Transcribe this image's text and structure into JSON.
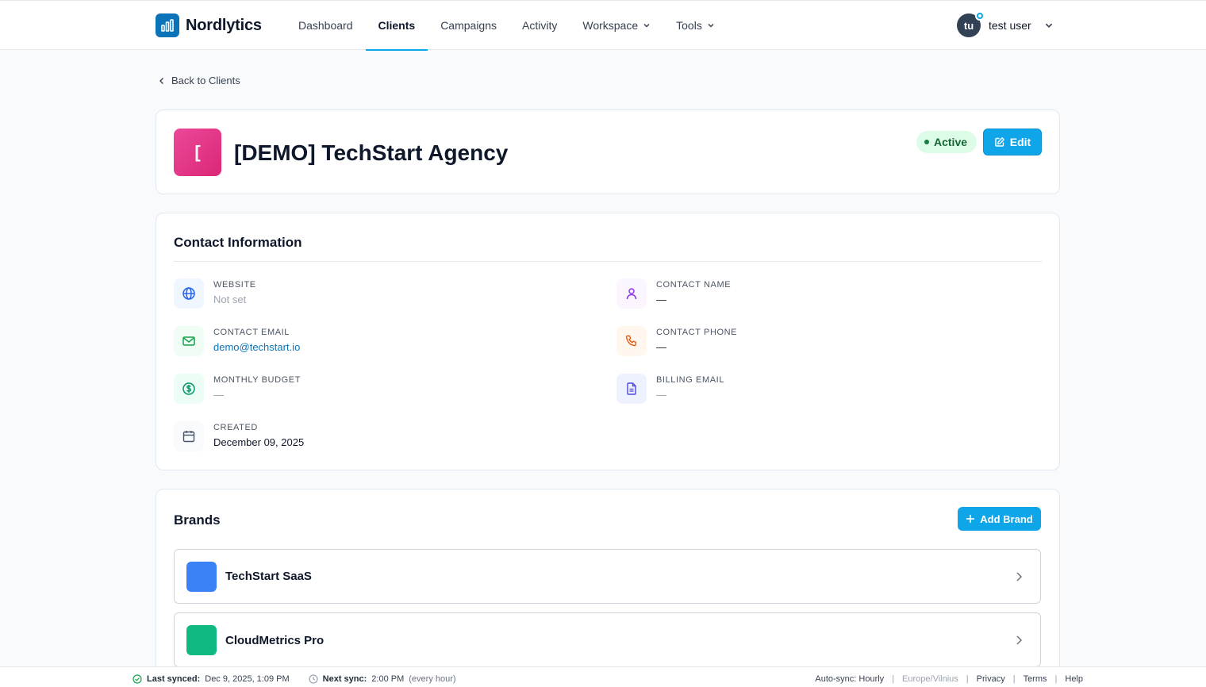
{
  "app": {
    "name": "Nordlytics"
  },
  "nav": {
    "items": [
      {
        "label": "Dashboard"
      },
      {
        "label": "Clients"
      },
      {
        "label": "Campaigns"
      },
      {
        "label": "Activity"
      },
      {
        "label": "Workspace"
      },
      {
        "label": "Tools"
      }
    ],
    "active": "Clients"
  },
  "user": {
    "initials": "tu",
    "name": "test user"
  },
  "back_link": "Back to Clients",
  "client": {
    "initial": "[",
    "title": "[DEMO] TechStart Agency",
    "status": "Active",
    "edit_label": "Edit"
  },
  "contact": {
    "title": "Contact Information",
    "website": {
      "label": "Website",
      "value": "Not set"
    },
    "contact_name": {
      "label": "Contact Name",
      "value": "—"
    },
    "contact_email": {
      "label": "Contact Email",
      "value": "demo@techstart.io"
    },
    "contact_phone": {
      "label": "Contact Phone",
      "value": "—"
    },
    "monthly_budget": {
      "label": "Monthly Budget",
      "value": "—"
    },
    "billing_email": {
      "label": "Billing Email",
      "value": "—"
    },
    "created": {
      "label": "Created",
      "value": "December 09, 2025"
    }
  },
  "brands": {
    "title": "Brands",
    "add_label": "Add Brand",
    "items": [
      {
        "name": "TechStart SaaS",
        "color": "#3b82f6"
      },
      {
        "name": "CloudMetrics Pro",
        "color": "#10b981"
      }
    ]
  },
  "footer": {
    "last_synced_label": "Last synced:",
    "last_synced_value": "Dec 9, 2025, 1:09 PM",
    "next_sync_label": "Next sync:",
    "next_sync_value": "2:00 PM",
    "next_sync_note": "(every hour)",
    "auto_sync": "Auto-sync: Hourly",
    "timezone": "Europe/Vilnius",
    "links": [
      "Privacy",
      "Terms",
      "Help"
    ]
  },
  "colors": {
    "accent": "#0ea5e9",
    "brand": "#0b74b8",
    "active_badge_bg": "#dcfce7"
  }
}
